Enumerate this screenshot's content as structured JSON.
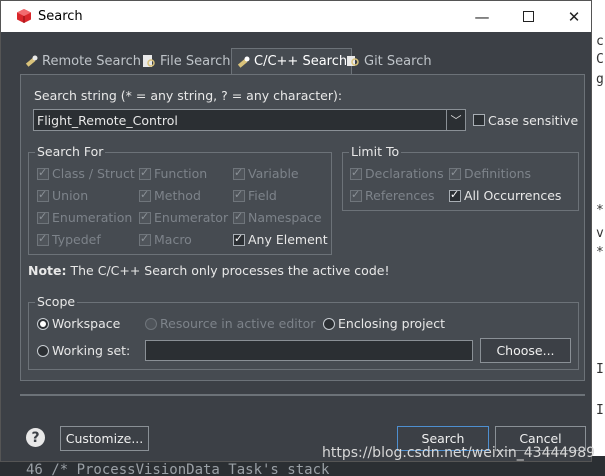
{
  "window": {
    "title": "Search"
  },
  "tabs": [
    {
      "label": "Remote Search",
      "icon": "flashlight-icon"
    },
    {
      "label": "File Search",
      "icon": "file-search-icon"
    },
    {
      "label": "C/C++ Search",
      "icon": "flashlight-icon",
      "active": true
    },
    {
      "label": "Git Search",
      "icon": "git-search-icon"
    }
  ],
  "search": {
    "label": "Search string (* = any string, ? = any character):",
    "value": "Flight_Remote_Control",
    "case_sensitive_label": "Case sensitive",
    "case_sensitive": false
  },
  "search_for": {
    "title": "Search For",
    "options": [
      {
        "label": "Class / Struct",
        "checked": true,
        "enabled": false
      },
      {
        "label": "Function",
        "checked": true,
        "enabled": false
      },
      {
        "label": "Variable",
        "checked": true,
        "enabled": false
      },
      {
        "label": "Union",
        "checked": true,
        "enabled": false
      },
      {
        "label": "Method",
        "checked": true,
        "enabled": false
      },
      {
        "label": "Field",
        "checked": true,
        "enabled": false
      },
      {
        "label": "Enumeration",
        "checked": true,
        "enabled": false
      },
      {
        "label": "Enumerator",
        "checked": true,
        "enabled": false
      },
      {
        "label": "Namespace",
        "checked": true,
        "enabled": false
      },
      {
        "label": "Typedef",
        "checked": true,
        "enabled": false
      },
      {
        "label": "Macro",
        "checked": true,
        "enabled": false
      },
      {
        "label": "Any Element",
        "checked": true,
        "enabled": true
      }
    ]
  },
  "limit_to": {
    "title": "Limit To",
    "options": [
      {
        "label": "Declarations",
        "checked": true,
        "enabled": false
      },
      {
        "label": "Definitions",
        "checked": true,
        "enabled": false
      },
      {
        "label": "References",
        "checked": true,
        "enabled": false
      },
      {
        "label": "All Occurrences",
        "checked": true,
        "enabled": true
      }
    ]
  },
  "note": {
    "bold": "Note:",
    "text": "The C/C++ Search only processes the active code!"
  },
  "scope": {
    "title": "Scope",
    "workspace": "Workspace",
    "resource": "Resource in active editor",
    "enclosing": "Enclosing project",
    "working_set": "Working set:",
    "working_set_value": "",
    "choose": "Choose..."
  },
  "buttons": {
    "customize": "Customize...",
    "search": "Search",
    "cancel": "Cancel",
    "help": "?"
  },
  "background": {
    "right_chars": [
      "c",
      "C",
      "g",
      "*",
      "v",
      "*",
      "I",
      "I"
    ],
    "bottom_code": "46 /* ProcessVisionData Task's stack"
  },
  "watermark": "https://blog.csdn.net/weixin_43444989",
  "colors": {
    "accent": "#4e8fd0",
    "dialog_bg": "#3c4046",
    "panel_bg": "#464b51"
  }
}
